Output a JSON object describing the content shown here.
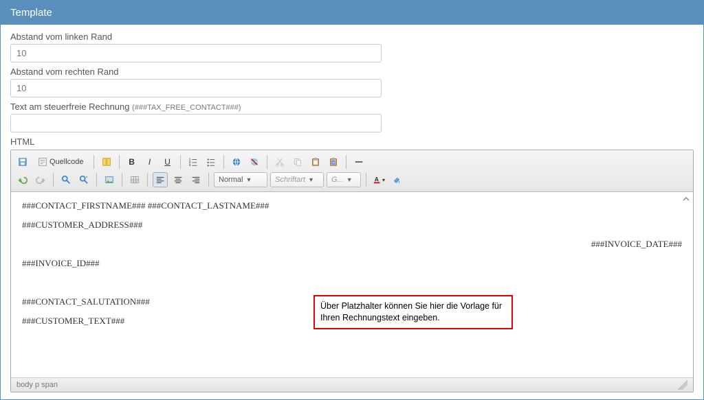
{
  "panel": {
    "title": "Template"
  },
  "fields": {
    "left_margin": {
      "label": "Abstand vom linken Rand",
      "value": "10"
    },
    "right_margin": {
      "label": "Abstand vom rechten Rand",
      "value": "10"
    },
    "tax_free": {
      "label": "Text am steuerfreie Rechnung ",
      "hint": "(###TAX_FREE_CONTACT###)",
      "value": ""
    },
    "html_label": "HTML"
  },
  "toolbar": {
    "source": "Quellcode",
    "select_normal": "Normal",
    "select_font": "Schriftart",
    "select_size": "G..."
  },
  "editor": {
    "line1": "###CONTACT_FIRSTNAME### ###CONTACT_LASTNAME###",
    "line2": "###CUSTOMER_ADDRESS###",
    "line_date": "###INVOICE_DATE###",
    "line_id": "###INVOICE_ID###",
    "line_sal": "###CONTACT_SALUTATION###",
    "line_text": "###CUSTOMER_TEXT###"
  },
  "annotation": "Über Platzhalter können Sie hier die Vorlage für Ihren Rechnungstext eingeben.",
  "status": {
    "path": "body  p  span"
  }
}
